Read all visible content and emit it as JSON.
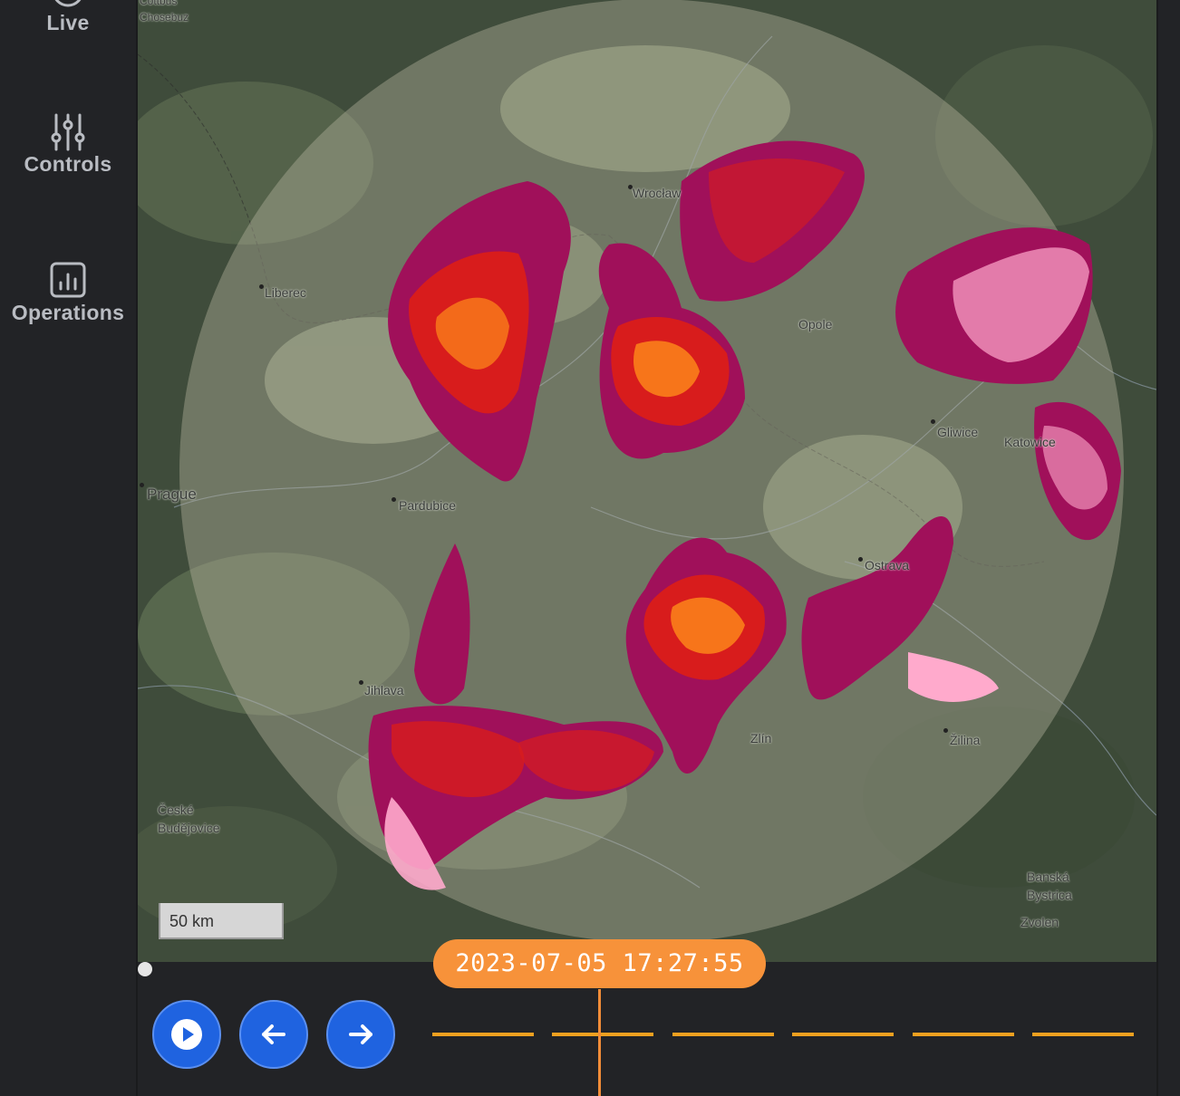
{
  "sidebar": {
    "items": [
      {
        "label": "Live",
        "icon": "radar-icon"
      },
      {
        "label": "Controls",
        "icon": "sliders-icon"
      },
      {
        "label": "Operations",
        "icon": "bar-chart-icon"
      }
    ]
  },
  "map": {
    "cities": [
      {
        "name": "Wrocław"
      },
      {
        "name": "Liberec"
      },
      {
        "name": "Opole"
      },
      {
        "name": "Gliwice"
      },
      {
        "name": "Katowice"
      },
      {
        "name": "Prague"
      },
      {
        "name": "Pardubice"
      },
      {
        "name": "Ostrava"
      },
      {
        "name": "Jihlava"
      },
      {
        "name": "Zlín"
      },
      {
        "name": "Žilina"
      },
      {
        "name": "České"
      },
      {
        "name": "Budějovice"
      },
      {
        "name": "Banská"
      },
      {
        "name": "Bystrica"
      },
      {
        "name": "Zvolen"
      },
      {
        "name": "Cottbus"
      },
      {
        "name": "Chosebuz"
      }
    ],
    "scale_label": "50 km"
  },
  "playback": {
    "timestamp": "2023-07-05 17:27:55",
    "play_icon": "play-icon",
    "prev_icon": "arrow-left-icon",
    "next_icon": "arrow-right-icon",
    "timeline_segments": 6
  },
  "colors": {
    "accent": "#f7923a",
    "button": "#1f63e0",
    "radar_high": "#a0105a",
    "radar_mid": "#d81c1c",
    "radar_core": "#ff8c1a",
    "radar_low": "#ffaacc"
  }
}
